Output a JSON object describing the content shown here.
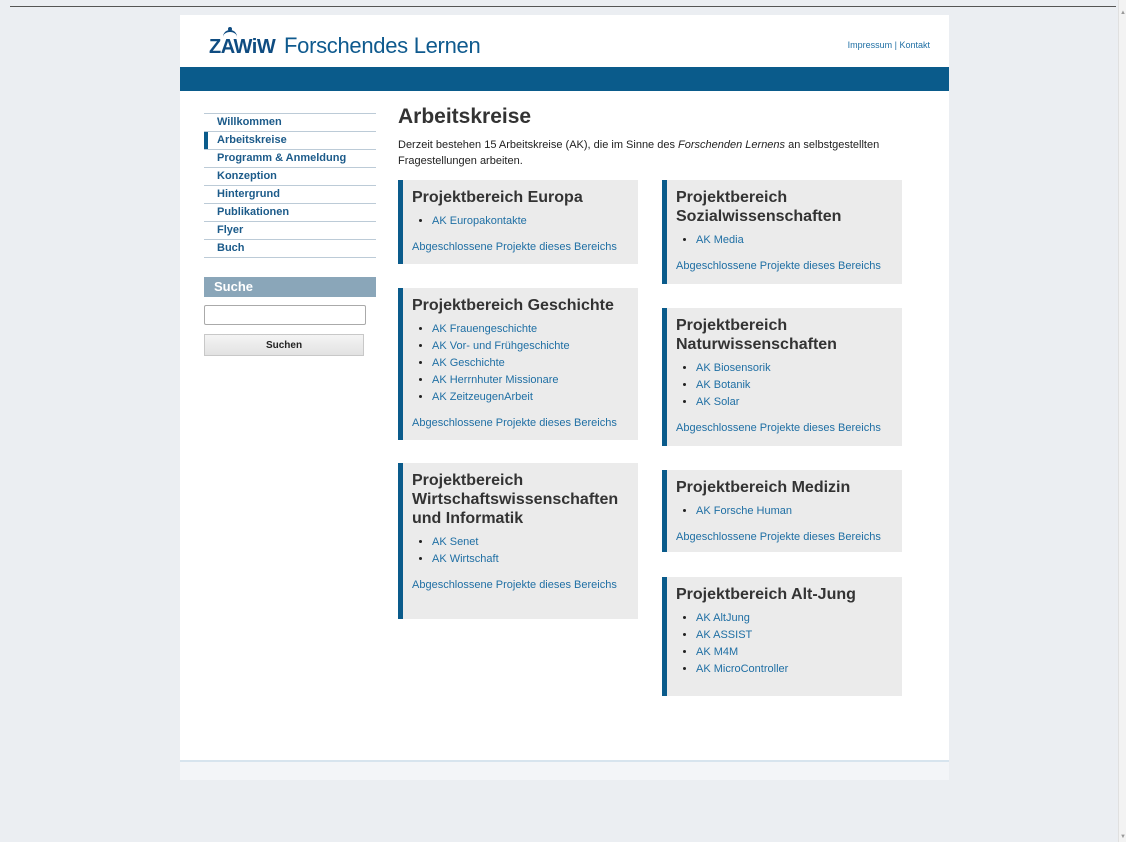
{
  "site": {
    "logo_text": "ZAWiW",
    "title": "Forschendes Lernen",
    "top_links": [
      "Impressum",
      "Kontakt"
    ],
    "top_links_separator": "|"
  },
  "nav": {
    "items": [
      {
        "label": "Willkommen",
        "active": false
      },
      {
        "label": "Arbeitskreise",
        "active": true
      },
      {
        "label": "Programm & Anmeldung",
        "active": false
      },
      {
        "label": "Konzeption",
        "active": false
      },
      {
        "label": "Hintergrund",
        "active": false
      },
      {
        "label": "Publikationen",
        "active": false
      },
      {
        "label": "Flyer",
        "active": false
      },
      {
        "label": "Buch",
        "active": false
      }
    ]
  },
  "search": {
    "heading": "Suche",
    "value": "",
    "button_label": "Suchen"
  },
  "main": {
    "title": "Arbeitskreise",
    "intro_before": "Derzeit bestehen 15 Arbeitskreise (AK), die im Sinne des ",
    "intro_em": "Forschenden Lernens",
    "intro_after": " an selbstgestellten Fragestellungen arbeiten."
  },
  "areas": [
    {
      "title": "Projektbereich Europa",
      "items": [
        "AK Europakontakte"
      ],
      "done_link": "Abgeschlossene Projekte dieses Bereichs"
    },
    {
      "title": "Projektbereich Geschichte",
      "items": [
        "AK Frauengeschichte",
        "AK Vor- und Frühgeschichte",
        "AK Geschichte",
        "AK Herrnhuter Missionare",
        "AK ZeitzeugenArbeit"
      ],
      "done_link": "Abgeschlossene Projekte dieses Bereichs"
    },
    {
      "title": "Projektbereich Wirtschaftswissenschaften und Informatik",
      "items": [
        "AK Senet",
        "AK Wirtschaft"
      ],
      "done_link": "Abgeschlossene Projekte dieses Bereichs"
    },
    {
      "title": "Projektbereich Sozialwissenschaften",
      "items": [
        "AK Media"
      ],
      "done_link": "Abgeschlossene Projekte dieses Bereichs"
    },
    {
      "title": "Projektbereich Naturwissenschaften",
      "items": [
        "AK Biosensorik",
        "AK Botanik",
        "AK Solar"
      ],
      "done_link": "Abgeschlossene Projekte dieses Bereichs"
    },
    {
      "title": "Projektbereich Medizin",
      "items": [
        "AK Forsche Human"
      ],
      "done_link": "Abgeschlossene Projekte dieses Bereichs"
    },
    {
      "title": "Projektbereich Alt-Jung",
      "items": [
        "AK AltJung",
        "AK ASSIST",
        "AK M4M",
        "AK MicroController"
      ],
      "done_link": ""
    }
  ],
  "colors": {
    "brand": "#0a5b8b",
    "link": "#1f6fa4",
    "box_bg": "#ebebeb",
    "search_head": "#8aa6b9"
  }
}
